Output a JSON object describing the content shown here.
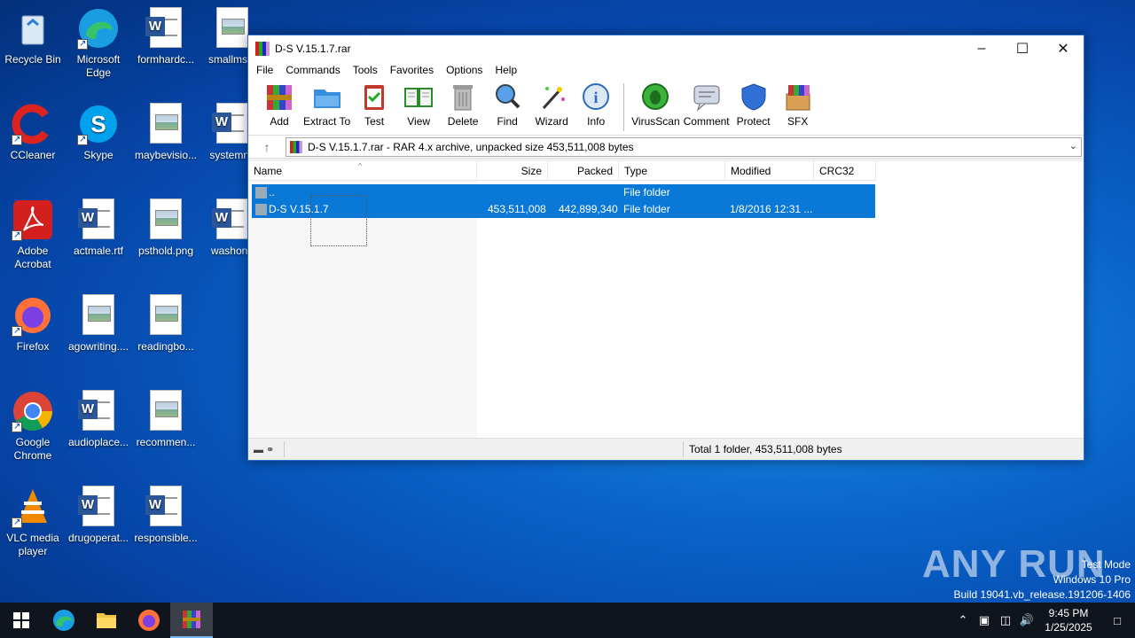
{
  "desktop": {
    "icons": [
      {
        "name": "recycle-bin",
        "label": "Recycle Bin"
      },
      {
        "name": "microsoft-edge",
        "label": "Microsoft Edge"
      },
      {
        "name": "formhardc",
        "label": "formhardc..."
      },
      {
        "name": "smallms",
        "label": "smallms.p"
      },
      {
        "name": "ccleaner",
        "label": "CCleaner"
      },
      {
        "name": "skype",
        "label": "Skype"
      },
      {
        "name": "maybevisio",
        "label": "maybevisio..."
      },
      {
        "name": "systemne",
        "label": "systemne"
      },
      {
        "name": "adobe-acrobat",
        "label": "Adobe Acrobat"
      },
      {
        "name": "actmale",
        "label": "actmale.rtf"
      },
      {
        "name": "psthold",
        "label": "psthold.png"
      },
      {
        "name": "washone",
        "label": "washone"
      },
      {
        "name": "firefox",
        "label": "Firefox"
      },
      {
        "name": "agowriting",
        "label": "agowriting...."
      },
      {
        "name": "readingbo",
        "label": "readingbo..."
      },
      {
        "name": "google-chrome",
        "label": "Google Chrome"
      },
      {
        "name": "audioplace",
        "label": "audioplace..."
      },
      {
        "name": "recommen",
        "label": "recommen..."
      },
      {
        "name": "vlc",
        "label": "VLC media player"
      },
      {
        "name": "drugoperat",
        "label": "drugoperat..."
      },
      {
        "name": "responsible",
        "label": "responsible..."
      }
    ]
  },
  "window": {
    "title": "D-S V.15.1.7.rar",
    "menu": [
      "File",
      "Commands",
      "Tools",
      "Favorites",
      "Options",
      "Help"
    ],
    "toolbar": [
      "Add",
      "Extract To",
      "Test",
      "View",
      "Delete",
      "Find",
      "Wizard",
      "Info",
      "VirusScan",
      "Comment",
      "Protect",
      "SFX"
    ],
    "address": "D-S V.15.1.7.rar - RAR 4.x archive, unpacked size 453,511,008 bytes",
    "columns": [
      "Name",
      "Size",
      "Packed",
      "Type",
      "Modified",
      "CRC32"
    ],
    "rows": [
      {
        "name": "..",
        "size": "",
        "packed": "",
        "type": "File folder",
        "modified": "",
        "crc": ""
      },
      {
        "name": "D-S V.15.1.7",
        "size": "453,511,008",
        "packed": "442,899,340",
        "type": "File folder",
        "modified": "1/8/2016 12:31 ...",
        "crc": ""
      }
    ],
    "status": "Total 1 folder, 453,511,008 bytes"
  },
  "watermark": {
    "brand": "ANY RUN",
    "line1": "Test Mode",
    "line2": "Windows 10 Pro",
    "line3": "Build 19041.vb_release.191206-1406"
  },
  "clock": {
    "time": "9:45 PM",
    "date": "1/25/2025"
  },
  "colors": {
    "selection": "#0a78d7",
    "desktop": "#0a64c9",
    "taskbar": "#10141c"
  }
}
